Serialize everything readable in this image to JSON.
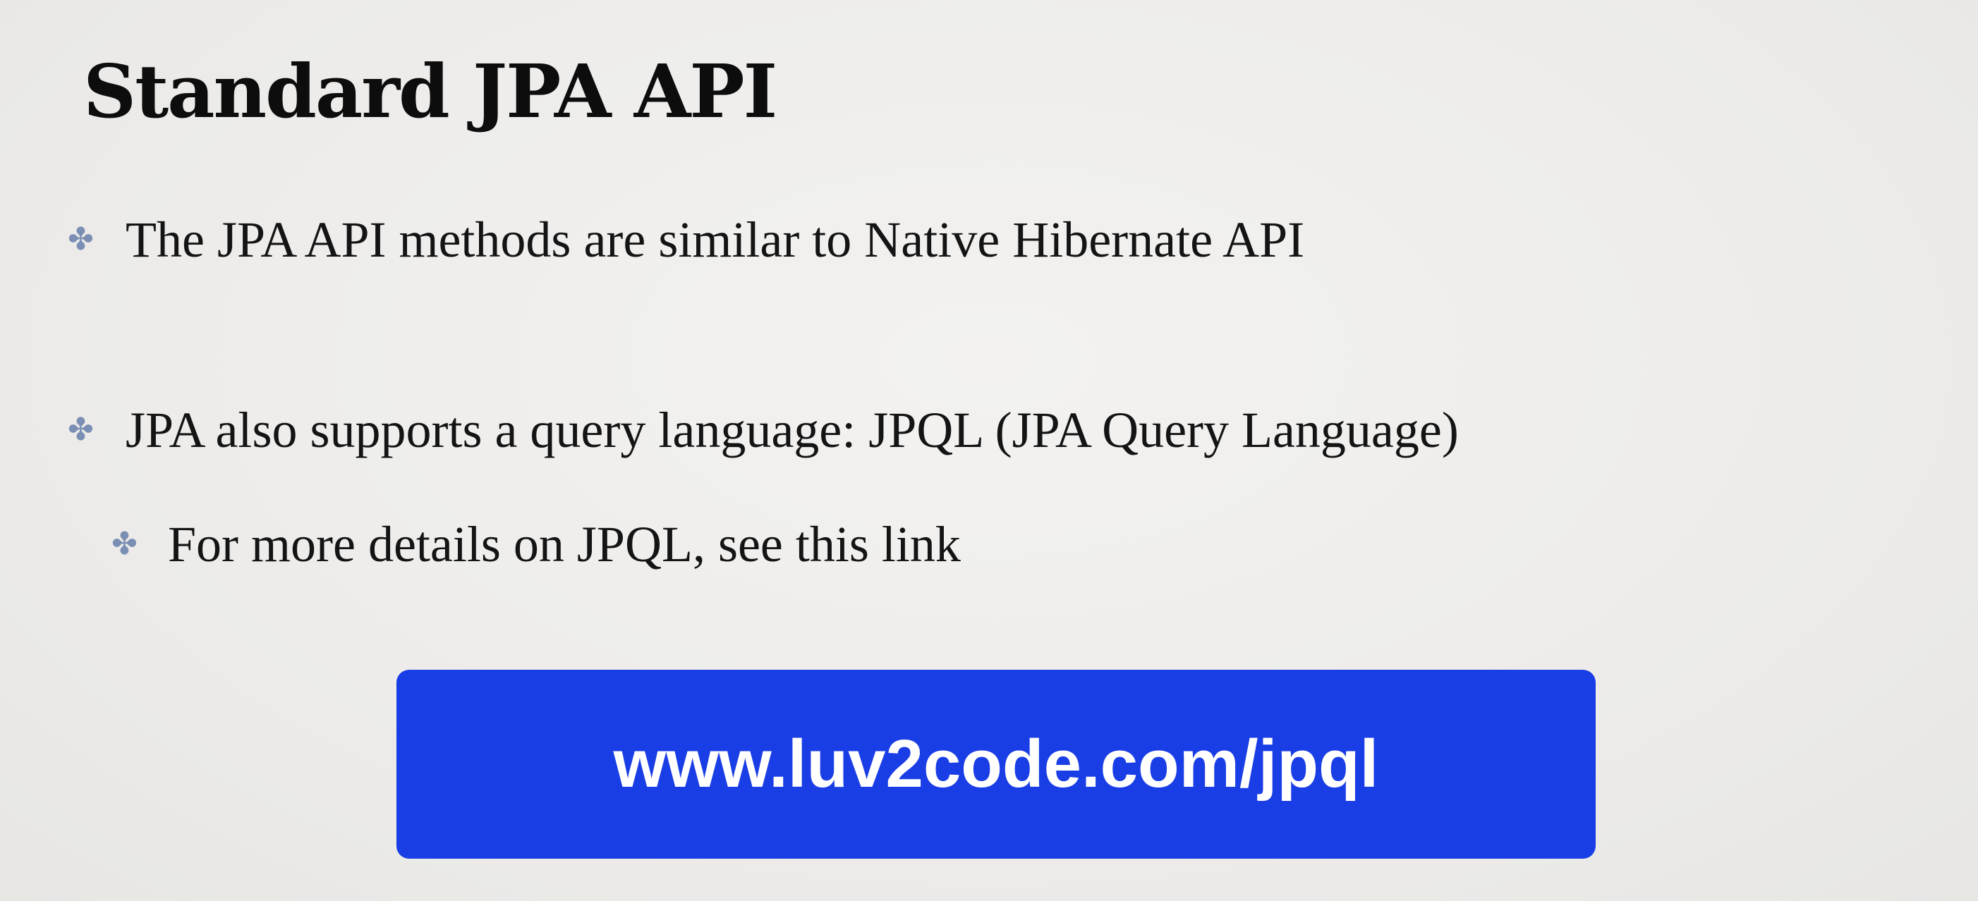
{
  "slide": {
    "title": "Standard JPA API",
    "bullets": [
      {
        "icon": "four-point-star-bullet-icon",
        "text": "The JPA API methods are similar to Native Hibernate API"
      },
      {
        "icon": "four-point-star-bullet-icon",
        "text": "JPA also supports a query language: JPQL  (JPA Query Language)"
      },
      {
        "icon": "four-point-star-bullet-icon",
        "text": "For more details on JPQL, see this link"
      }
    ],
    "link": {
      "label": "www.luv2code.com/jpql"
    }
  },
  "colors": {
    "background": "#efeeec",
    "bullet": "#7a8fb3",
    "link_button": "#1a3ee5",
    "link_text": "#ffffff"
  }
}
